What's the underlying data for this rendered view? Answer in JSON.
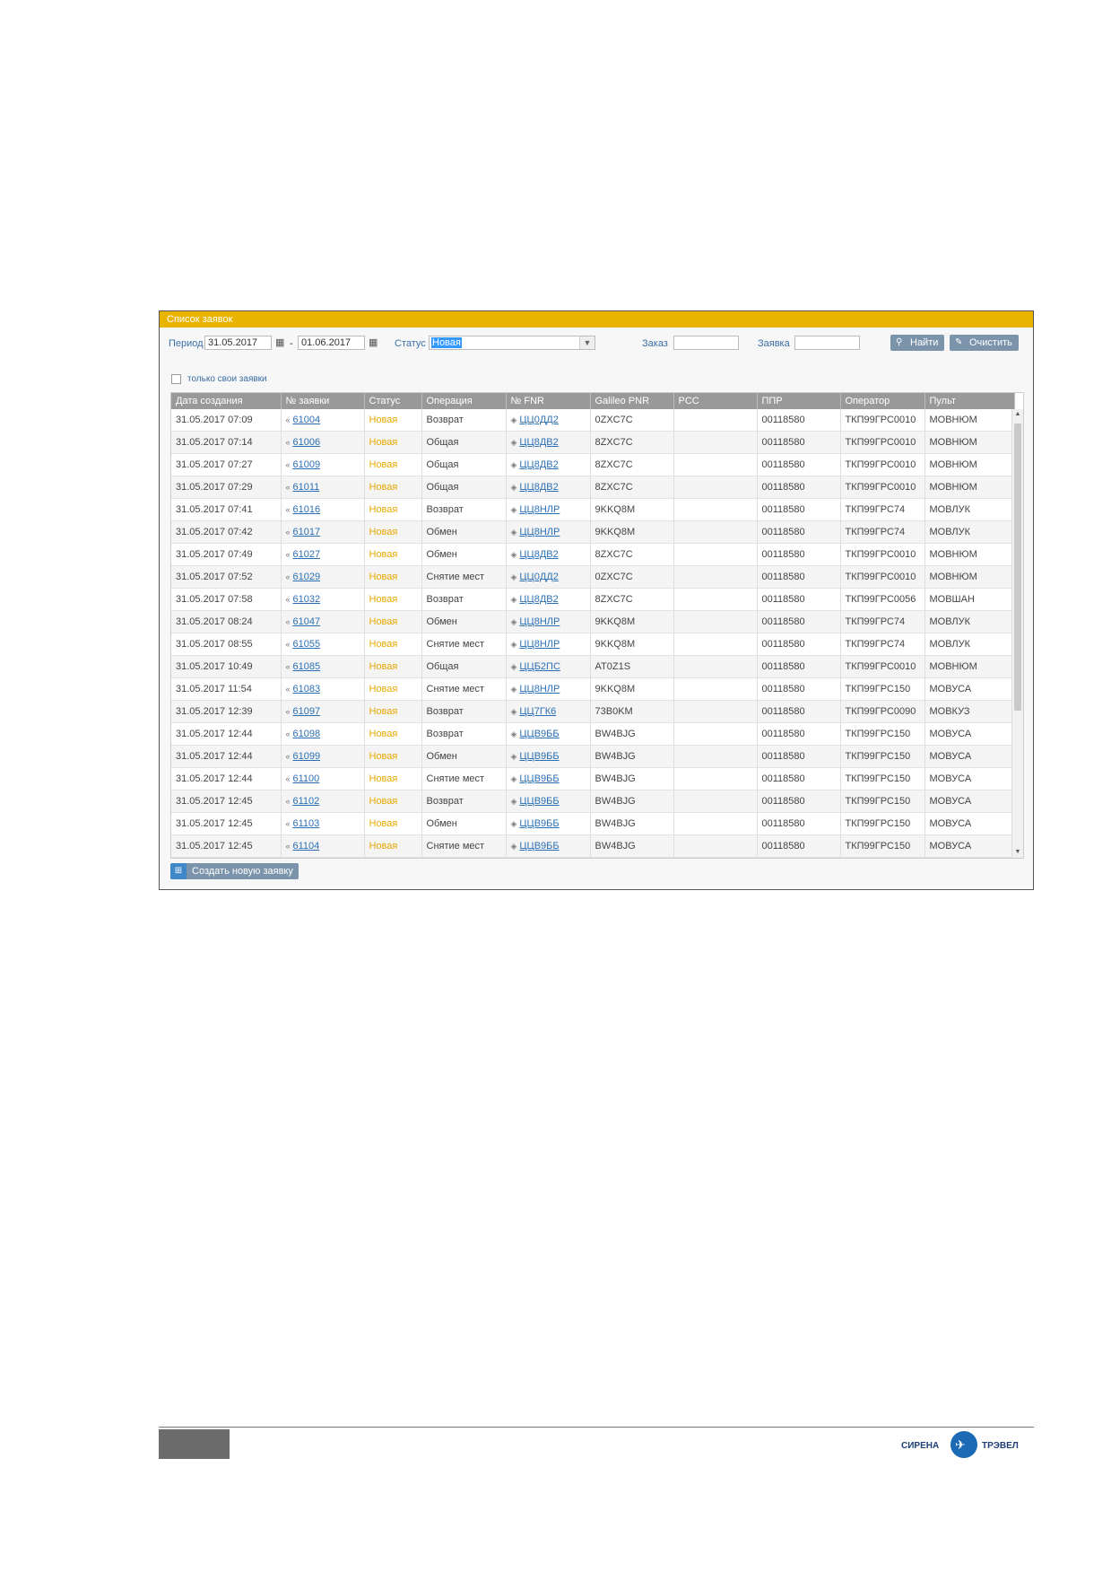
{
  "panel": {
    "title": "Список заявок",
    "filters": {
      "period_label": "Период",
      "date_from": "31.05.2017",
      "date_sep": "-",
      "date_to": "01.06.2017",
      "status_label": "Статус",
      "status_value": "Новая",
      "order_label": "Заказ",
      "order_value": "",
      "request_label": "Заявка",
      "request_value": "",
      "find_button": "Найти",
      "clear_button": "Очистить",
      "only_mine_label": "только свои заявки"
    },
    "table": {
      "columns": [
        "Дата создания",
        "№ заявки",
        "Статус",
        "Операция",
        "№ FNR",
        "Galileo PNR",
        "PCC",
        "ППР",
        "Оператор",
        "Пульт"
      ],
      "rows": [
        [
          "31.05.2017 07:09",
          "61004",
          "Новая",
          "Возврат",
          "ЦЦ0ДД2",
          "0ZXC7C",
          "",
          "00118580",
          "ТКП99ГРС0010",
          "МОВНЮМ"
        ],
        [
          "31.05.2017 07:14",
          "61006",
          "Новая",
          "Общая",
          "ЦЦ8ДВ2",
          "8ZXC7C",
          "",
          "00118580",
          "ТКП99ГРС0010",
          "МОВНЮМ"
        ],
        [
          "31.05.2017 07:27",
          "61009",
          "Новая",
          "Общая",
          "ЦЦ8ДВ2",
          "8ZXC7C",
          "",
          "00118580",
          "ТКП99ГРС0010",
          "МОВНЮМ"
        ],
        [
          "31.05.2017 07:29",
          "61011",
          "Новая",
          "Общая",
          "ЦЦ8ДВ2",
          "8ZXC7C",
          "",
          "00118580",
          "ТКП99ГРС0010",
          "МОВНЮМ"
        ],
        [
          "31.05.2017 07:41",
          "61016",
          "Новая",
          "Возврат",
          "ЦЦ8НЛР",
          "9KKQ8M",
          "",
          "00118580",
          "ТКП99ГРС74",
          "МОВЛУК"
        ],
        [
          "31.05.2017 07:42",
          "61017",
          "Новая",
          "Обмен",
          "ЦЦ8НЛР",
          "9KKQ8M",
          "",
          "00118580",
          "ТКП99ГРС74",
          "МОВЛУК"
        ],
        [
          "31.05.2017 07:49",
          "61027",
          "Новая",
          "Обмен",
          "ЦЦ8ДВ2",
          "8ZXC7C",
          "",
          "00118580",
          "ТКП99ГРС0010",
          "МОВНЮМ"
        ],
        [
          "31.05.2017 07:52",
          "61029",
          "Новая",
          "Снятие мест",
          "ЦЦ0ДД2",
          "0ZXC7C",
          "",
          "00118580",
          "ТКП99ГРС0010",
          "МОВНЮМ"
        ],
        [
          "31.05.2017 07:58",
          "61032",
          "Новая",
          "Возврат",
          "ЦЦ8ДВ2",
          "8ZXC7C",
          "",
          "00118580",
          "ТКП99ГРС0056",
          "МОВШАН"
        ],
        [
          "31.05.2017 08:24",
          "61047",
          "Новая",
          "Обмен",
          "ЦЦ8НЛР",
          "9KKQ8M",
          "",
          "00118580",
          "ТКП99ГРС74",
          "МОВЛУК"
        ],
        [
          "31.05.2017 08:55",
          "61055",
          "Новая",
          "Снятие мест",
          "ЦЦ8НЛР",
          "9KKQ8M",
          "",
          "00118580",
          "ТКП99ГРС74",
          "МОВЛУК"
        ],
        [
          "31.05.2017 10:49",
          "61085",
          "Новая",
          "Общая",
          "ЦЦБ2ПС",
          "AT0Z1S",
          "",
          "00118580",
          "ТКП99ГРС0010",
          "МОВНЮМ"
        ],
        [
          "31.05.2017 11:54",
          "61083",
          "Новая",
          "Снятие мест",
          "ЦЦ8НЛР",
          "9KKQ8M",
          "",
          "00118580",
          "ТКП99ГРС150",
          "МОВУСА"
        ],
        [
          "31.05.2017 12:39",
          "61097",
          "Новая",
          "Возврат",
          "ЦЦ7ГК6",
          "73B0KM",
          "",
          "00118580",
          "ТКП99ГРС0090",
          "МОВКУЗ"
        ],
        [
          "31.05.2017 12:44",
          "61098",
          "Новая",
          "Возврат",
          "ЦЦВ9ББ",
          "BW4BJG",
          "",
          "00118580",
          "ТКП99ГРС150",
          "МОВУСА"
        ],
        [
          "31.05.2017 12:44",
          "61099",
          "Новая",
          "Обмен",
          "ЦЦВ9ББ",
          "BW4BJG",
          "",
          "00118580",
          "ТКП99ГРС150",
          "МОВУСА"
        ],
        [
          "31.05.2017 12:44",
          "61100",
          "Новая",
          "Снятие мест",
          "ЦЦВ9ББ",
          "BW4BJG",
          "",
          "00118580",
          "ТКП99ГРС150",
          "МОВУСА"
        ],
        [
          "31.05.2017 12:45",
          "61102",
          "Новая",
          "Возврат",
          "ЦЦВ9ББ",
          "BW4BJG",
          "",
          "00118580",
          "ТКП99ГРС150",
          "МОВУСА"
        ],
        [
          "31.05.2017 12:45",
          "61103",
          "Новая",
          "Обмен",
          "ЦЦВ9ББ",
          "BW4BJG",
          "",
          "00118580",
          "ТКП99ГРС150",
          "МОВУСА"
        ],
        [
          "31.05.2017 12:45",
          "61104",
          "Новая",
          "Снятие мест",
          "ЦЦВ9ББ",
          "BW4BJG",
          "",
          "00118580",
          "ТКП99ГРС150",
          "МОВУСА"
        ]
      ]
    },
    "create_button": "Создать новую заявку"
  },
  "footer": {
    "logo_left": "СИРЕНА",
    "logo_right": "ТРЭВЕЛ"
  },
  "colors": {
    "header_accent": "#e8b400",
    "status_new": "#e8a800",
    "link": "#2a6fb5",
    "button": "#7c94ab"
  },
  "icons": {
    "calendar": "calendar-icon",
    "search": "search-icon",
    "eraser": "eraser-icon",
    "row_marker": "arrow-right-icon",
    "add": "add-icon"
  }
}
